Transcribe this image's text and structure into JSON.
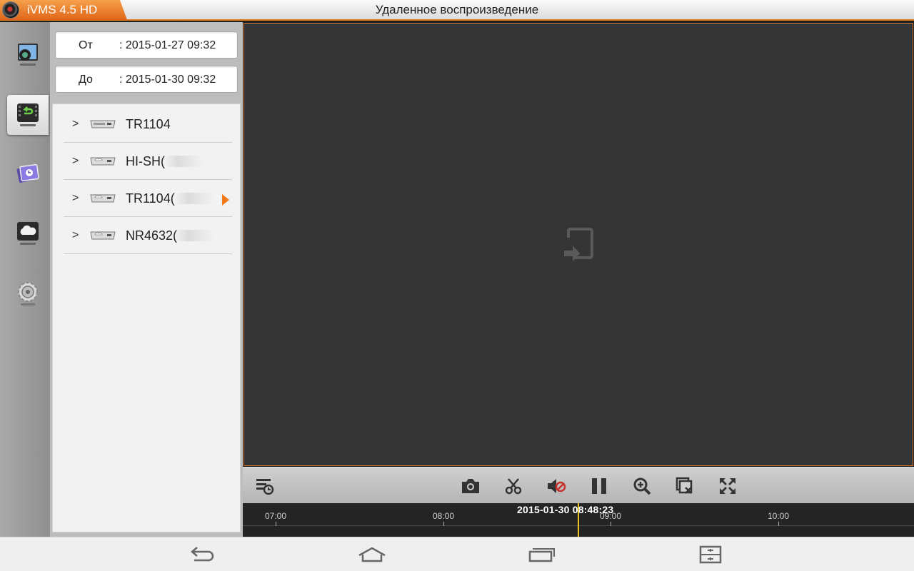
{
  "app": {
    "name": "iVMS 4.5 HD",
    "page_title": "Удаленное воспроизведение",
    "accent": "#e07a1c"
  },
  "nav": [
    {
      "icon": "live-view-camera-icon",
      "active": false
    },
    {
      "icon": "remote-playback-icon",
      "active": true
    },
    {
      "icon": "local-files-icon",
      "active": false
    },
    {
      "icon": "cloud-device-icon",
      "active": false
    },
    {
      "icon": "settings-gear-icon",
      "active": false
    }
  ],
  "time_range": {
    "from_label": "От",
    "from_value": ": 2015-01-27  09:32",
    "to_label": "До",
    "to_value": ": 2015-01-30  09:32"
  },
  "devices": [
    {
      "name": "TR1104",
      "type": "dvr",
      "selected": false
    },
    {
      "name": "HI-SH(",
      "type": "cloud",
      "selected": false
    },
    {
      "name": "TR1104(",
      "type": "cloud",
      "selected": true
    },
    {
      "name": "NR4632(",
      "type": "cloud",
      "selected": false
    }
  ],
  "toolbar": [
    "playback-list-icon",
    "snapshot-icon",
    "clip-icon",
    "mute-icon",
    "pause-icon",
    "zoom-icon",
    "close-window-icon",
    "fullscreen-icon"
  ],
  "timeline": {
    "ticks": [
      "07:00",
      "08:00",
      "09:00",
      "10:00"
    ],
    "current_time": "2015-01-30 08:48:23"
  },
  "system_nav": [
    "back-icon",
    "home-icon",
    "recent-apps-icon",
    "screenshot-icon"
  ]
}
